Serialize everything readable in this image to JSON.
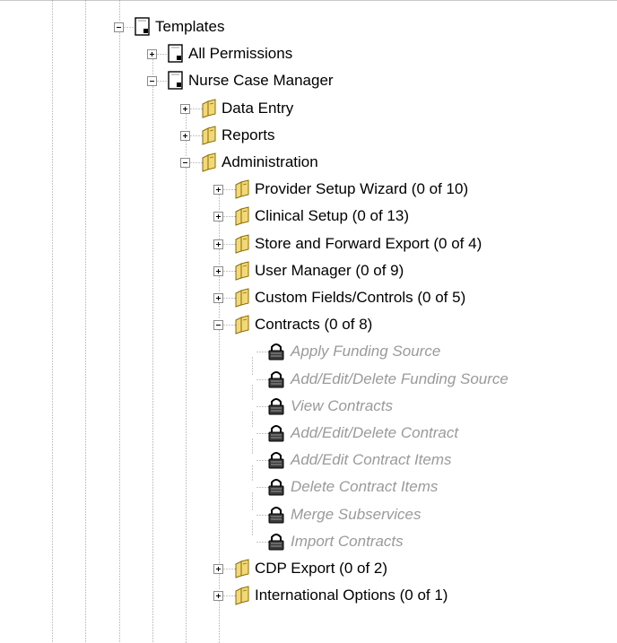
{
  "tree": {
    "nodes": [
      {
        "label": "Templates",
        "level": 0,
        "icon": "document-icon",
        "state": "expanded"
      },
      {
        "label": "All Permissions",
        "level": 1,
        "icon": "document-icon",
        "state": "collapsed"
      },
      {
        "label": "Nurse Case Manager",
        "level": 1,
        "icon": "document-icon",
        "state": "expanded"
      },
      {
        "label": "Data Entry",
        "level": 2,
        "icon": "folder-icon",
        "state": "collapsed"
      },
      {
        "label": "Reports",
        "level": 2,
        "icon": "folder-icon",
        "state": "collapsed"
      },
      {
        "label": "Administration",
        "level": 2,
        "icon": "folder-icon",
        "state": "expanded"
      },
      {
        "label": "Provider Setup Wizard (0 of 10)",
        "level": 3,
        "icon": "folder-icon",
        "state": "collapsed"
      },
      {
        "label": "Clinical Setup (0 of 13)",
        "level": 3,
        "icon": "folder-icon",
        "state": "collapsed"
      },
      {
        "label": "Store and Forward Export (0 of 4)",
        "level": 3,
        "icon": "folder-icon",
        "state": "collapsed"
      },
      {
        "label": "User Manager (0 of 9)",
        "level": 3,
        "icon": "folder-icon",
        "state": "collapsed"
      },
      {
        "label": "Custom Fields/Controls (0 of 5)",
        "level": 3,
        "icon": "folder-icon",
        "state": "collapsed"
      },
      {
        "label": "Contracts (0 of 8)",
        "level": 3,
        "icon": "folder-icon",
        "state": "expanded"
      },
      {
        "label": "Apply Funding Source",
        "level": 4,
        "icon": "lock-icon",
        "state": "leaf",
        "disabled": true
      },
      {
        "label": "Add/Edit/Delete Funding Source",
        "level": 4,
        "icon": "lock-icon",
        "state": "leaf",
        "disabled": true
      },
      {
        "label": "View Contracts",
        "level": 4,
        "icon": "lock-icon",
        "state": "leaf",
        "disabled": true
      },
      {
        "label": "Add/Edit/Delete Contract",
        "level": 4,
        "icon": "lock-icon",
        "state": "leaf",
        "disabled": true
      },
      {
        "label": "Add/Edit Contract Items",
        "level": 4,
        "icon": "lock-icon",
        "state": "leaf",
        "disabled": true
      },
      {
        "label": "Delete Contract Items",
        "level": 4,
        "icon": "lock-icon",
        "state": "leaf",
        "disabled": true
      },
      {
        "label": "Merge Subservices",
        "level": 4,
        "icon": "lock-icon",
        "state": "leaf",
        "disabled": true
      },
      {
        "label": "Import Contracts",
        "level": 4,
        "icon": "lock-icon",
        "state": "leaf",
        "disabled": true
      },
      {
        "label": "CDP Export (0 of 2)",
        "level": 3,
        "icon": "folder-icon",
        "state": "collapsed"
      },
      {
        "label": "International Options (0 of 1)",
        "level": 3,
        "icon": "folder-icon",
        "state": "collapsed"
      }
    ]
  },
  "colors": {
    "tree_line": "#8c8c8c",
    "disabled_text": "#9a9a9a",
    "folder_fill": "#f2d878",
    "folder_edge": "#8a6d00"
  }
}
